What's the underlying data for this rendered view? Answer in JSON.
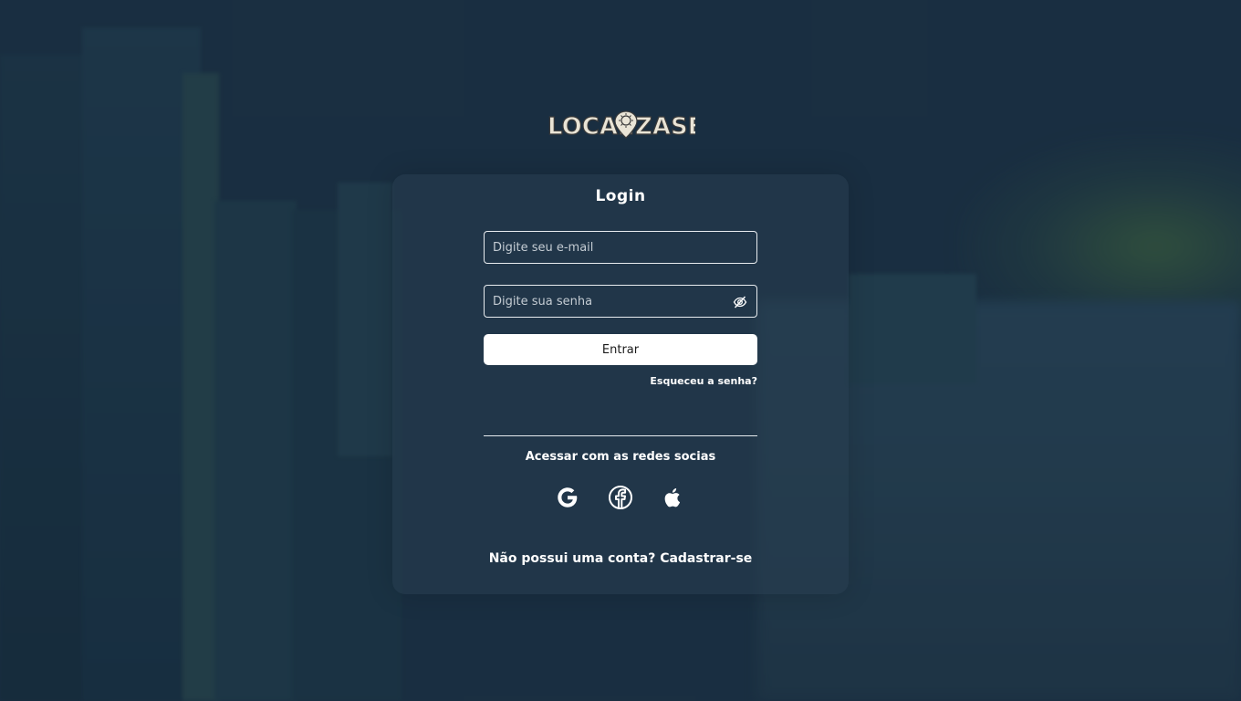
{
  "brand": {
    "logo_text": "LOCALIZASE"
  },
  "login": {
    "title": "Login",
    "email_placeholder": "Digite seu e-mail",
    "email_value": "",
    "password_placeholder": "Digite sua senha",
    "password_value": "",
    "submit_label": "Entrar",
    "forgot_label": "Esqueceu a senha?"
  },
  "social": {
    "label": "Acessar com as redes socias",
    "providers": [
      {
        "name": "Google",
        "icon": "google-icon"
      },
      {
        "name": "Facebook",
        "icon": "facebook-icon"
      },
      {
        "name": "Apple",
        "icon": "apple-icon"
      }
    ]
  },
  "signup": {
    "prompt": "Não possui uma conta?",
    "link_label": "Cadastrar-se"
  },
  "colors": {
    "background": "#1d3447",
    "card": "#283e50",
    "text": "#ffffff",
    "button_bg": "#ffffff",
    "button_text": "#1b1b1b",
    "placeholder": "#c4ccd3"
  }
}
